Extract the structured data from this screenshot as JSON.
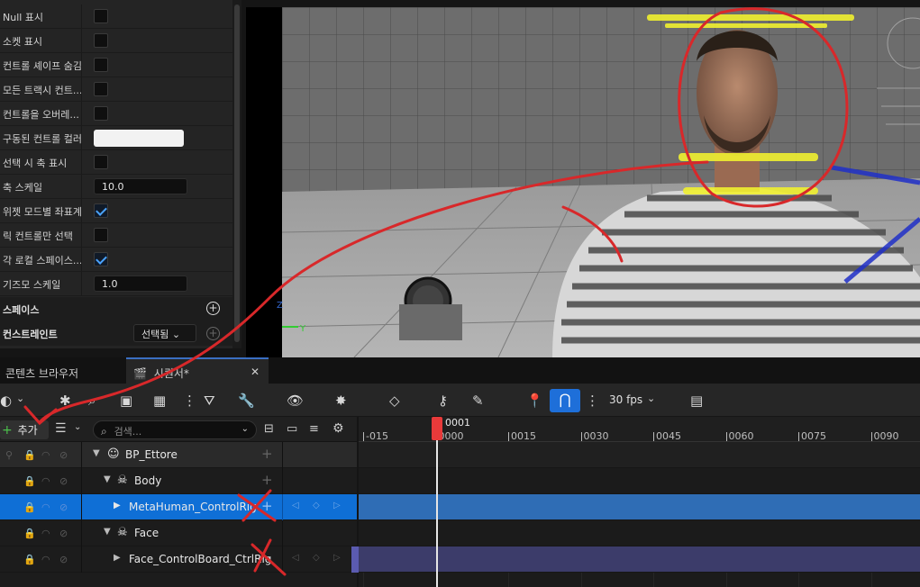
{
  "details": {
    "rows": [
      {
        "label": "Null 표시",
        "type": "check",
        "checked": false
      },
      {
        "label": "소켓 표시",
        "type": "check",
        "checked": false
      },
      {
        "label": "컨트롤 셰이프 숨김",
        "type": "check",
        "checked": false
      },
      {
        "label": "모든 트랙시 컨트...",
        "type": "check",
        "checked": false
      },
      {
        "label": "컨트롤을 오버레...",
        "type": "check",
        "checked": false
      },
      {
        "label": "구동된 컨트롤 컬러",
        "type": "color",
        "color": "#f2f2f2"
      },
      {
        "label": "선택 시 축 표시",
        "type": "check",
        "checked": false
      },
      {
        "label": "축 스케일",
        "type": "number",
        "value": "10.0"
      },
      {
        "label": "위젯 모드별 좌표계",
        "type": "check",
        "checked": true
      },
      {
        "label": "릭 컨트롤만 선택",
        "type": "check",
        "checked": false
      },
      {
        "label": "각 로컬 스페이스...",
        "type": "check",
        "checked": true
      },
      {
        "label": "기즈모 스케일",
        "type": "number",
        "value": "1.0"
      }
    ],
    "spaces_label": "스페이스",
    "constraints_label": "컨스트레인트",
    "constraints_dropdown": "선택됨"
  },
  "viewport": {
    "axis_y": "Y",
    "axis_z": "Z"
  },
  "tabs": {
    "content_browser": "콘텐츠 브라우저",
    "sequencer": "시퀀서*"
  },
  "toolbar": {
    "fps": "30 fps"
  },
  "outliner": {
    "add_label": "추가",
    "search_placeholder": "검색...",
    "rows": [
      {
        "label": "BP_Ettore",
        "icon": "actor-icon"
      },
      {
        "label": "Body",
        "icon": "skeleton-icon"
      },
      {
        "label": "MetaHuman_ControlRig",
        "icon": "track-icon"
      },
      {
        "label": "Face",
        "icon": "skeleton-icon"
      },
      {
        "label": "Face_ControlBoard_CtrlRig",
        "icon": "track-icon"
      }
    ]
  },
  "timeline": {
    "current_frame": "0001",
    "ticks": [
      "-015",
      "0000",
      "0015",
      "0030",
      "0045",
      "0060",
      "0075",
      "0090"
    ]
  },
  "colors": {
    "selection": "#0f6fd6",
    "track_body": "#2f6db5",
    "track_face": "#3c3c6a",
    "playhead": "#e83a3a",
    "annotation": "#d8282a"
  }
}
